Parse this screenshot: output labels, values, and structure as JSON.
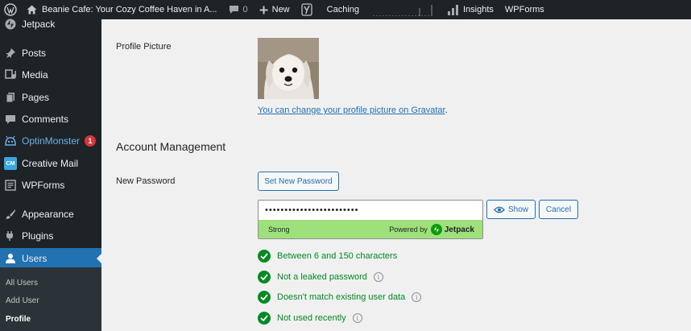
{
  "adminbar": {
    "site_title": "Beanie Cafe: Your Cozy Coffee Haven in A...",
    "comments_count": "0",
    "new_label": "New",
    "caching_label": "Caching",
    "insights_label": "Insights",
    "wpforms_label": "WPForms"
  },
  "sidebar": {
    "items": [
      {
        "label": "Jetpack",
        "icon": "jetpack-icon"
      },
      {
        "label": "Posts",
        "icon": "pin-icon"
      },
      {
        "label": "Media",
        "icon": "media-icon"
      },
      {
        "label": "Pages",
        "icon": "pages-icon"
      },
      {
        "label": "Comments",
        "icon": "comment-icon"
      },
      {
        "label": "OptinMonster",
        "icon": "optinmonster-icon",
        "badge": "1"
      },
      {
        "label": "Creative Mail",
        "icon": "creative-mail-icon",
        "icon_text": "CM"
      },
      {
        "label": "WPForms",
        "icon": "wpforms-icon"
      },
      {
        "label": "Appearance",
        "icon": "brush-icon"
      },
      {
        "label": "Plugins",
        "icon": "plugin-icon"
      },
      {
        "label": "Users",
        "icon": "user-icon"
      }
    ],
    "submenu": [
      "All Users",
      "Add User",
      "Profile"
    ]
  },
  "profile": {
    "picture_label": "Profile Picture",
    "gravatar_link": "You can change your profile picture on Gravatar",
    "gravatar_suffix": "."
  },
  "account": {
    "section_title": "Account Management",
    "new_password_label": "New Password",
    "set_new_password_button": "Set New Password",
    "password_value": "••••••••••••••••••••••••",
    "strength_label": "Strong",
    "powered_by_label": "Powered by",
    "powered_by_brand": "Jetpack",
    "show_button": "Show",
    "cancel_button": "Cancel",
    "rules": [
      {
        "text": "Between 6 and 150 characters",
        "info": false
      },
      {
        "text": "Not a leaked password",
        "info": true
      },
      {
        "text": "Doesn't match existing user data",
        "info": true
      },
      {
        "text": "Not used recently",
        "info": true
      }
    ]
  },
  "colors": {
    "accent": "#2271b1",
    "adminbar_bg": "#1d2327",
    "success": "#008a20",
    "meter_strong": "#9ee07a",
    "badge": "#d63638"
  }
}
